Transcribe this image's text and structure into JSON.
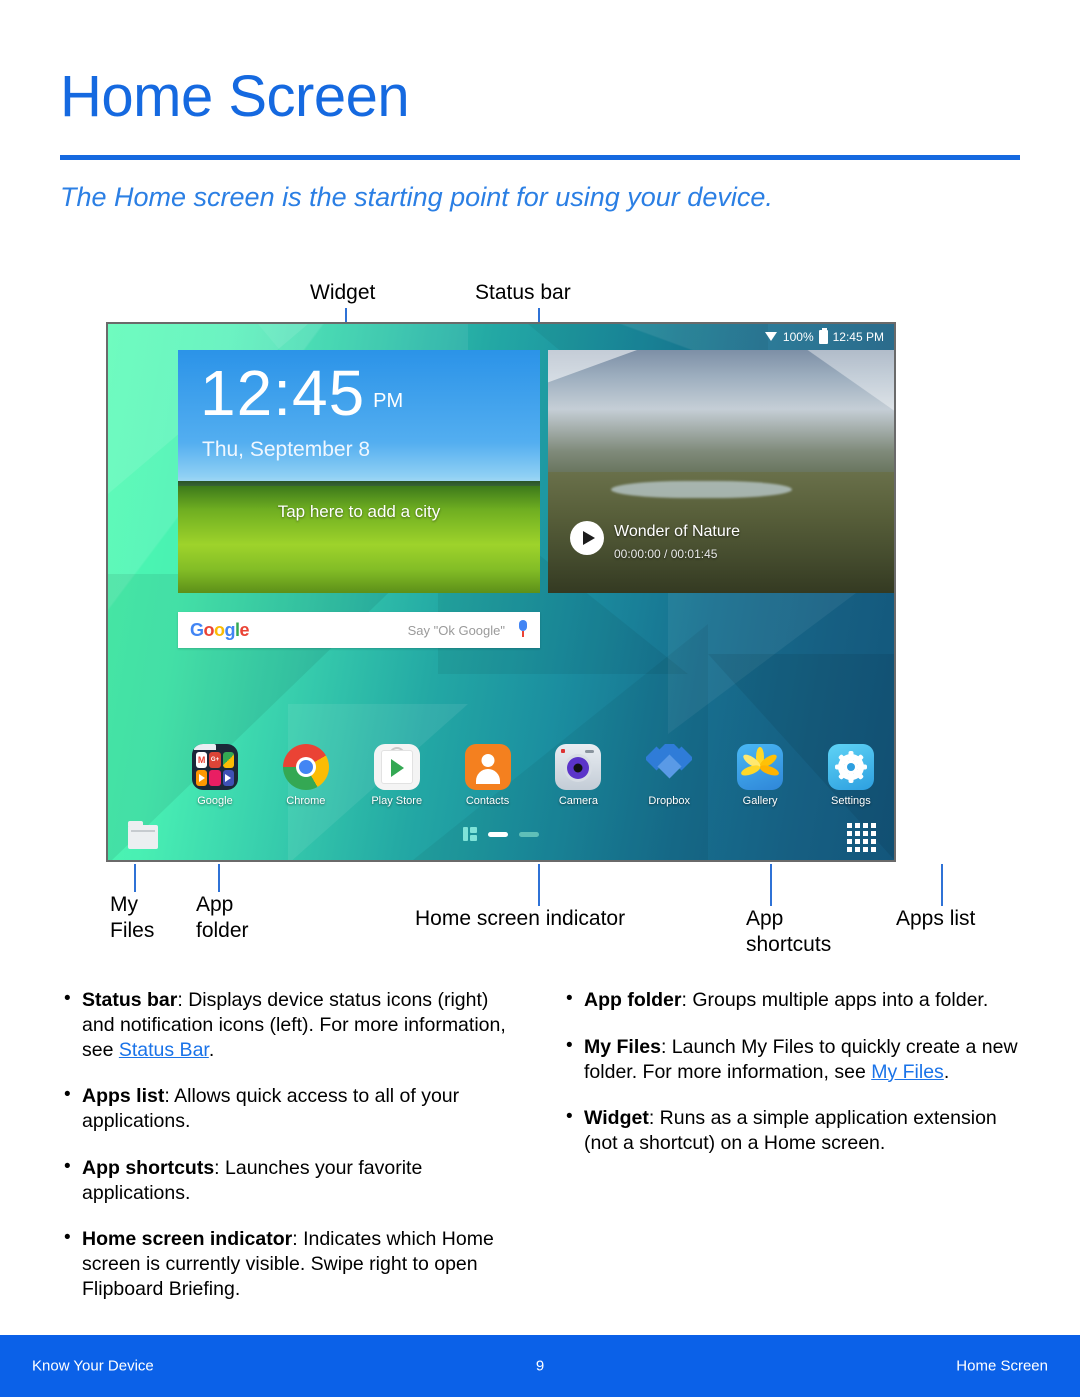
{
  "header": {
    "title": "Home Screen",
    "subtitle": "The Home screen is the starting point for using your device.",
    "accent_color": "#1569e0"
  },
  "callouts": {
    "widget": "Widget",
    "status_bar": "Status bar",
    "my_files": "My\nFiles",
    "my_files_l1": "My",
    "my_files_l2": "Files",
    "app_folder_l1": "App",
    "app_folder_l2": "folder",
    "home_screen_indicator": "Home screen indicator",
    "app_shortcuts_l1": "App",
    "app_shortcuts_l2": "shortcuts",
    "apps_list": "Apps list"
  },
  "device": {
    "status_bar": {
      "wifi_icon": "wifi-icon",
      "battery_percent": "100%",
      "battery_icon": "battery-icon",
      "time": "12:45 PM"
    },
    "clock_widget": {
      "time": "12:45",
      "meridiem": "PM",
      "date": "Thu, September 8",
      "city_hint": "Tap here to add a city"
    },
    "video_widget": {
      "title": "Wonder of Nature",
      "elapsed": "00:00:00",
      "separator": "/",
      "duration": "00:01:45",
      "timecode": "00:00:00 / 00:01:45",
      "play_icon": "play-icon"
    },
    "google_search": {
      "logo_letters": [
        "G",
        "o",
        "o",
        "g",
        "l",
        "e"
      ],
      "hint": "Say \"Ok Google\"",
      "mic_icon": "microphone-icon"
    },
    "app_shortcuts": [
      {
        "label": "Google",
        "icon": "google-folder-icon"
      },
      {
        "label": "Chrome",
        "icon": "chrome-icon"
      },
      {
        "label": "Play Store",
        "icon": "play-store-icon"
      },
      {
        "label": "Contacts",
        "icon": "contacts-icon"
      },
      {
        "label": "Camera",
        "icon": "camera-icon"
      },
      {
        "label": "Dropbox",
        "icon": "dropbox-icon"
      },
      {
        "label": "Gallery",
        "icon": "gallery-icon"
      },
      {
        "label": "Settings",
        "icon": "settings-icon"
      }
    ],
    "dock": {
      "my_files_icon": "my-files-folder-icon",
      "flipboard_icon": "flipboard-briefing-icon",
      "indicator_active": "home-screen-page-active",
      "indicator_inactive": "home-screen-page-inactive",
      "apps_list_icon": "apps-grid-icon"
    }
  },
  "bullets": {
    "left": [
      {
        "term": "Status bar",
        "text": ": Displays device status icons (right) and notification icons (left). For more information, see ",
        "link": "Status Bar",
        "tail": "."
      },
      {
        "term": "Apps list",
        "text": ": Allows quick access to all of your applications.",
        "link": "",
        "tail": ""
      },
      {
        "term": "App shortcuts",
        "text": ": Launches your favorite applications.",
        "link": "",
        "tail": ""
      },
      {
        "term": "Home screen indicator",
        "text": ": Indicates which Home screen is currently visible. Swipe right to open Flipboard Briefing.",
        "link": "",
        "tail": ""
      }
    ],
    "right": [
      {
        "term": "App folder",
        "text": ": Groups multiple apps into a folder.",
        "link": "",
        "tail": ""
      },
      {
        "term": "My Files",
        "text": ": Launch My Files to quickly create a new folder. For more information, see ",
        "link": "My Files",
        "tail": "."
      },
      {
        "term": "Widget",
        "text": ": Runs as a simple application extension (not a shortcut) on a Home screen.",
        "link": "",
        "tail": ""
      }
    ]
  },
  "footer": {
    "left": "Know Your Device",
    "page": "9",
    "right": "Home Screen",
    "background": "#0b61e8"
  }
}
